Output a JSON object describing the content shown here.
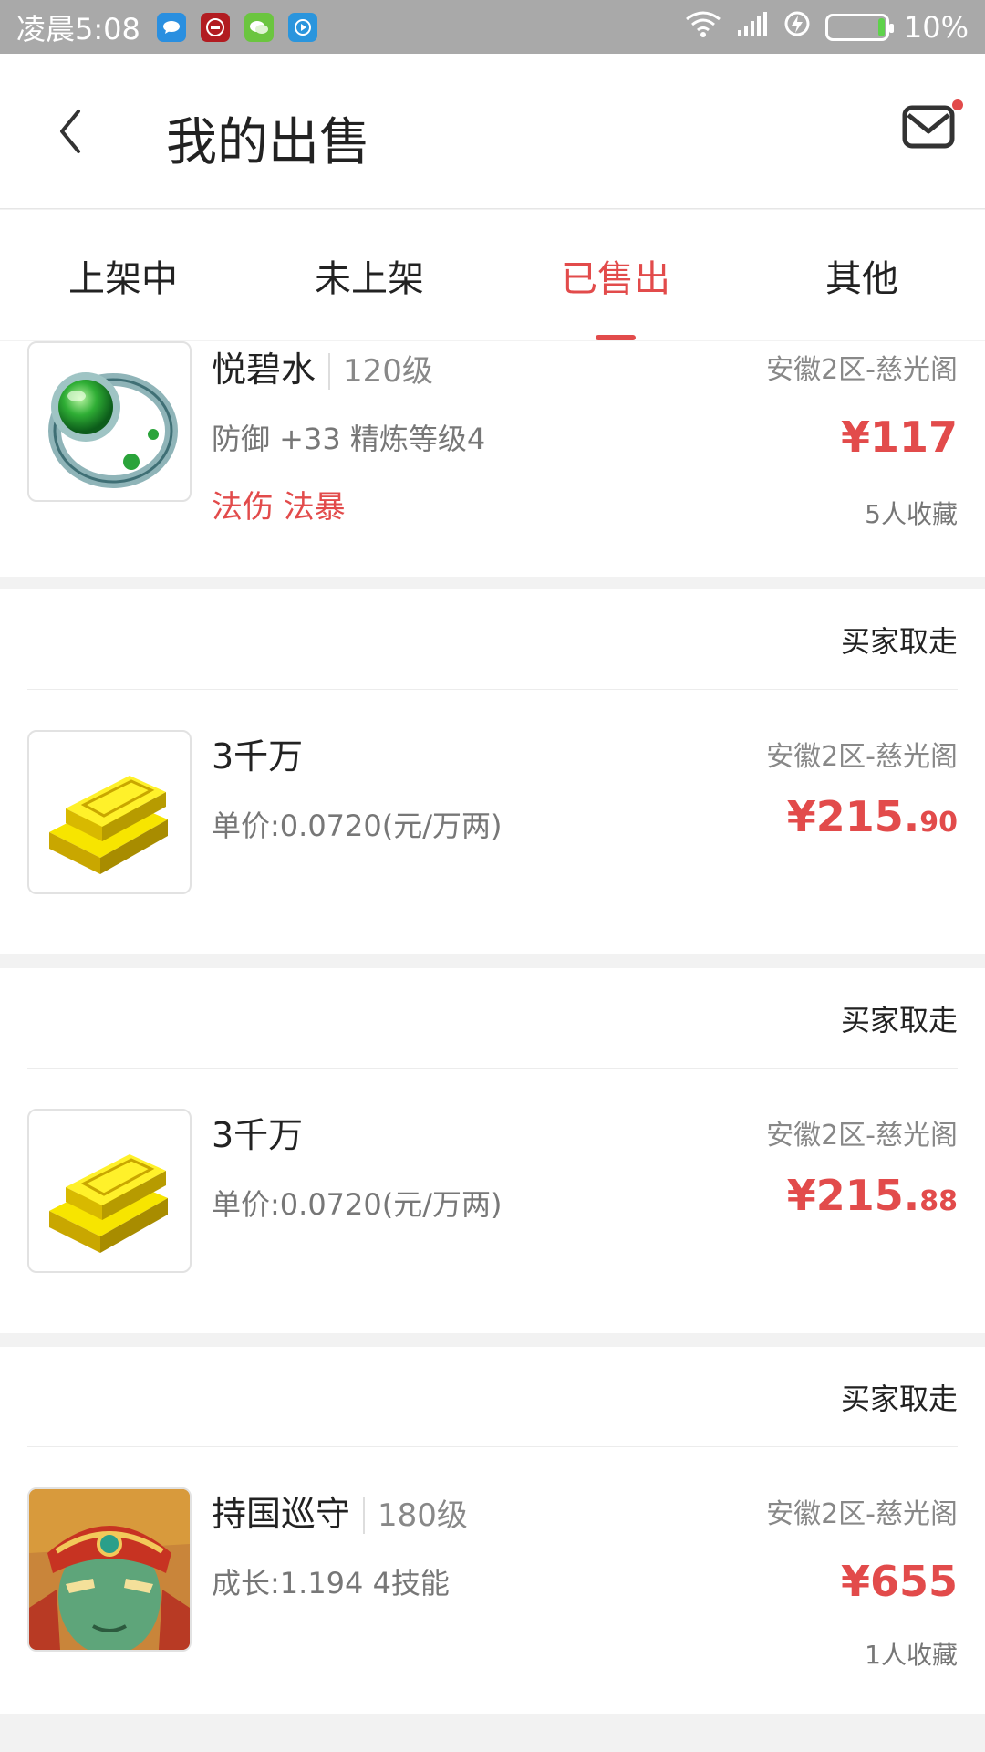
{
  "status": {
    "time": "凌晨5:08",
    "battery": "10%",
    "battery_level": 0.1,
    "apps": [
      {
        "icon": "chat-bubble-icon",
        "color": "#2a8fe0"
      },
      {
        "icon": "bank-icon",
        "color": "#b21c21"
      },
      {
        "icon": "wechat-icon",
        "color": "#6bc53f"
      },
      {
        "icon": "video-play-icon",
        "color": "#2a95dd"
      }
    ]
  },
  "header": {
    "title": "我的出售"
  },
  "tabs": [
    {
      "label": "上架中",
      "active": false
    },
    {
      "label": "未上架",
      "active": false
    },
    {
      "label": "已售出",
      "active": true
    },
    {
      "label": "其他",
      "active": false
    }
  ],
  "items": [
    {
      "name": "悦碧水",
      "level": "120级",
      "desc": "防御 +33 精炼等级4",
      "tags": "法伤 法暴",
      "server": "安徽2区-慈光阁",
      "price": "¥117",
      "favorites": "5人收藏",
      "icon": "jade-ring-icon"
    },
    {
      "status": "买家取走",
      "name": "3千万",
      "desc": "单价:0.0720(元/万两)",
      "server": "安徽2区-慈光阁",
      "price_main": "¥215.",
      "price_cents": "90",
      "icon": "gold-bars-icon"
    },
    {
      "status": "买家取走",
      "name": "3千万",
      "desc": "单价:0.0720(元/万两)",
      "server": "安徽2区-慈光阁",
      "price_main": "¥215.",
      "price_cents": "88",
      "icon": "gold-bars-icon"
    },
    {
      "status": "买家取走",
      "name": "持国巡守",
      "level": "180级",
      "desc": "成长:1.194 4技能",
      "server": "安徽2区-慈光阁",
      "price": "¥655",
      "favorites": "1人收藏",
      "icon": "guardian-avatar-icon"
    }
  ],
  "colors": {
    "accent": "#e24b4b",
    "statusbar": "#a9a9a9"
  }
}
